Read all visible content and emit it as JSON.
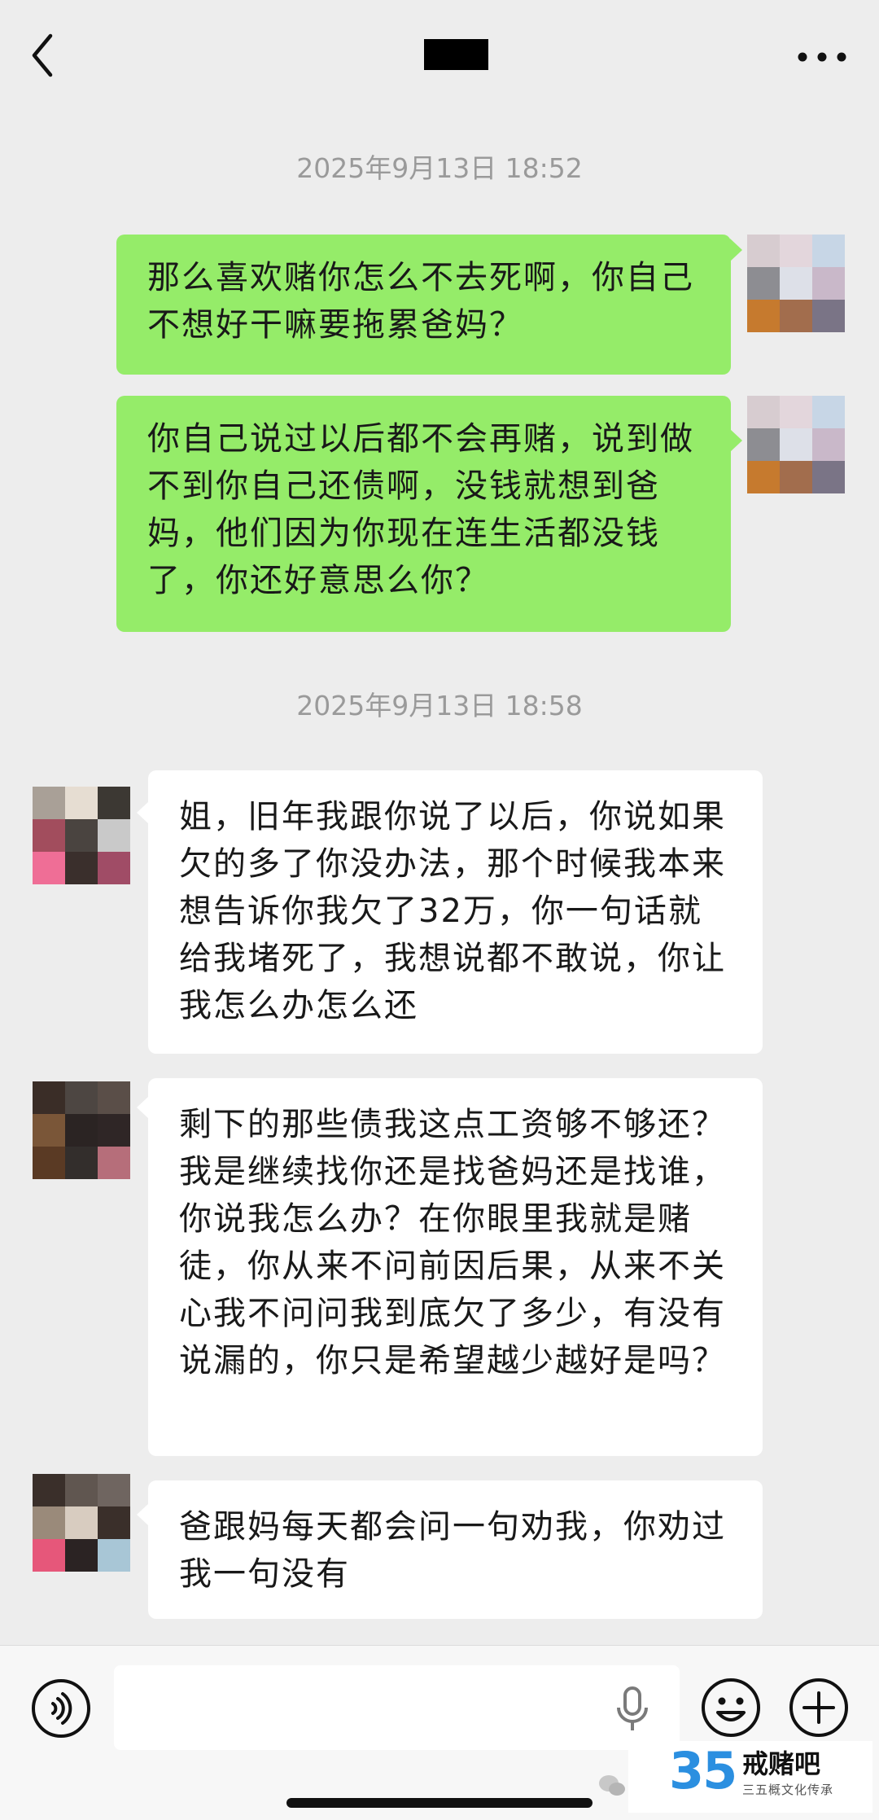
{
  "header": {
    "back_icon": "chevron-left-icon",
    "title_redacted": true,
    "more_icon": "more-horizontal-icon"
  },
  "messages": {
    "timestamps": [
      "2025年9月13日 18:52",
      "2025年9月13日 18:58"
    ],
    "sent": [
      "那么喜欢赌你怎么不去死啊，你自己不想好干嘛要拖累爸妈？",
      "你自己说过以后都不会再赌，说到做不到你自己还债啊，没钱就想到爸妈，他们因为你现在连生活都没钱了，你还好意思么你？"
    ],
    "received": [
      "姐，旧年我跟你说了以后，你说如果欠的多了你没办法，那个时候我本来想告诉你我欠了32万，你一句话就给我堵死了，我想说都不敢说，你让我怎么办怎么还",
      "剩下的那些债我这点工资够不够还？我是继续找你还是找爸妈还是找谁，你说我怎么办？在你眼里我就是赌徒，你从来不问前因后果，从来不关心我不问问我到底欠了多少，有没有说漏的，你只是希望越少越好是吗？",
      "爸跟妈每天都会问一句劝我，你劝过我一句没有"
    ]
  },
  "avatars": {
    "self": [
      "#d7ccd0",
      "#e3d6dc",
      "#c7d6e6",
      "#8d8d92",
      "#dde0e8",
      "#c9b8c9",
      "#c67a2e",
      "#a26d4d",
      "#7a7486"
    ],
    "other_1": [
      "#a9a097",
      "#e6ddd2",
      "#3c3833",
      "#a24d5d",
      "#4a4440",
      "#c9c9c9",
      "#ef6e96",
      "#3a2f2c",
      "#a04c66"
    ],
    "other_2": [
      "#3a2d27",
      "#4d4642",
      "#5a4e48",
      "#7a5638",
      "#2b2423",
      "#2f2626",
      "#5a3a24",
      "#332e2c",
      "#b66e7a"
    ],
    "other_3": [
      "#3a2f2a",
      "#605650",
      "#6f6560",
      "#9a8a7a",
      "#d8ccc0",
      "#3a2f2a",
      "#e6577a",
      "#2b2323",
      "#a8c6d6"
    ]
  },
  "input_bar": {
    "voice_icon": "voice-icon",
    "mic_icon": "microphone-icon",
    "emoji_icon": "emoji-icon",
    "plus_icon": "plus-icon"
  },
  "watermark": {
    "logo_number": "35",
    "title": "戒赌吧",
    "subtitle": "三五概文化传承"
  },
  "colors": {
    "background": "#ededed",
    "sent_bubble": "#95ec69",
    "received_bubble": "#ffffff",
    "timestamp": "#9a9a9a"
  }
}
